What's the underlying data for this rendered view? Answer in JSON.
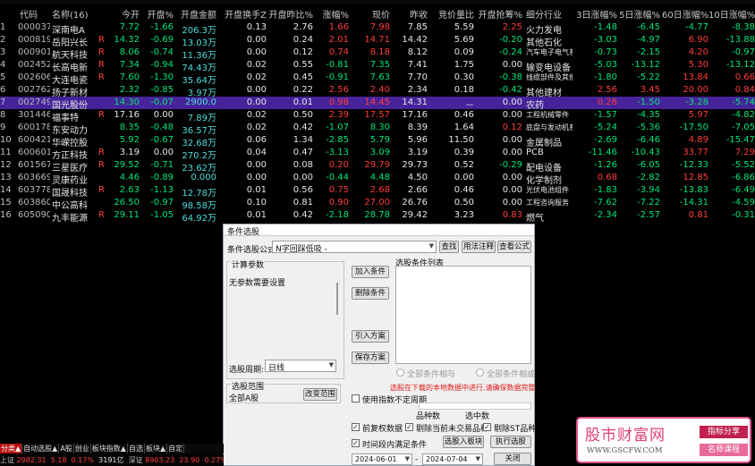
{
  "columns": [
    "代码",
    "名称(16)",
    "今开",
    "开盘%",
    "开盘金额",
    "开盘换手Z",
    "开盘昨比%",
    "涨幅%",
    "现价",
    "昨收",
    "竞价量比",
    "开盘抢筹%",
    "细分行业",
    "3日涨幅%",
    "5日涨幅%",
    "60日涨幅%",
    "10日涨幅%"
  ],
  "rows": [
    {
      "idx": "1",
      "code": "000037",
      "name": "深南电A",
      "mark": "",
      "open": "7.72",
      "open_pct": "-1.66",
      "amt": "206.3万",
      "turnover": "0.13",
      "prev_ratio": "2.76",
      "chg": "1.66",
      "price": "7.98",
      "prev": "7.85",
      "vol_ratio": "5.59",
      "grab": "2.25",
      "ind": "火力发电",
      "d3": "-1.48",
      "d5": "-6.45",
      "d60": "-4.77",
      "d10": "-8.38"
    },
    {
      "idx": "2",
      "code": "000819",
      "name": "岳阳兴长",
      "mark": "R",
      "open": "14.32",
      "open_pct": "-0.69",
      "amt": "13.03万",
      "turnover": "0.00",
      "prev_ratio": "0.24",
      "chg": "2.01",
      "price": "14.71",
      "prev": "14.42",
      "vol_ratio": "5.69",
      "grab": "-0.20",
      "ind": "其他石化",
      "d3": "-3.03",
      "d5": "-4.97",
      "d60": "6.90",
      "d10": "-13.88"
    },
    {
      "idx": "3",
      "code": "000901",
      "name": "航天科技",
      "mark": "R",
      "open": "8.06",
      "open_pct": "-0.74",
      "amt": "11.36万",
      "turnover": "0.00",
      "prev_ratio": "0.12",
      "chg": "0.74",
      "price": "8.18",
      "prev": "8.12",
      "vol_ratio": "0.09",
      "grab": "-0.24",
      "ind": "汽车电子电气系",
      "d3": "-0.73",
      "d5": "-2.15",
      "d60": "4.20",
      "d10": "-0.97"
    },
    {
      "idx": "4",
      "code": "002452",
      "name": "长高电新",
      "mark": "R",
      "open": "7.34",
      "open_pct": "-0.94",
      "amt": "74.43万",
      "turnover": "0.02",
      "prev_ratio": "0.55",
      "chg": "-0.81",
      "price": "7.35",
      "prev": "7.41",
      "vol_ratio": "1.75",
      "grab": "0.00",
      "ind": "输变电设备",
      "d3": "-5.03",
      "d5": "-13.12",
      "d60": "5.30",
      "d10": "-13.12"
    },
    {
      "idx": "5",
      "code": "002606",
      "name": "大连电瓷",
      "mark": "R",
      "open": "7.60",
      "open_pct": "-1.30",
      "amt": "35.64万",
      "turnover": "0.02",
      "prev_ratio": "0.45",
      "chg": "-0.91",
      "price": "7.63",
      "prev": "7.70",
      "vol_ratio": "0.30",
      "grab": "-0.38",
      "ind": "线缆部件及其他",
      "d3": "-1.80",
      "d5": "-5.22",
      "d60": "13.84",
      "d10": "0.66"
    },
    {
      "idx": "6",
      "code": "002762",
      "name": "扬子新材",
      "mark": "",
      "open": "2.32",
      "open_pct": "-0.85",
      "amt": "3.97万",
      "turnover": "0.00",
      "prev_ratio": "0.22",
      "chg": "2.56",
      "price": "2.40",
      "prev": "2.34",
      "vol_ratio": "0.18",
      "grab": "-0.42",
      "ind": "其他建材",
      "d3": "2.56",
      "d5": "3.45",
      "d60": "20.00",
      "d10": "0.84"
    },
    {
      "idx": "7",
      "code": "002749",
      "name": "国光股份",
      "mark": "",
      "open": "14.30",
      "open_pct": "-0.07",
      "amt": "2900.0",
      "turnover": "0.00",
      "prev_ratio": "0.01",
      "chg": "0.98",
      "price": "14.45",
      "prev": "14.31",
      "vol_ratio": "－",
      "grab": "0.00",
      "ind": "农药",
      "d3": "0.28",
      "d5": "-1.50",
      "d60": "-3.28",
      "d10": "-5.74"
    },
    {
      "idx": "8",
      "code": "301446",
      "name": "福事特",
      "mark": "R",
      "open": "17.16",
      "open_pct": "0.00",
      "amt": "7.89万",
      "turnover": "0.02",
      "prev_ratio": "0.50",
      "chg": "2.39",
      "price": "17.57",
      "prev": "17.16",
      "vol_ratio": "0.46",
      "grab": "0.00",
      "ind": "工程机械零件",
      "d3": "-1.57",
      "d5": "-4.35",
      "d60": "5.97",
      "d10": "-4.82"
    },
    {
      "idx": "9",
      "code": "600178",
      "name": "东安动力",
      "mark": "",
      "open": "8.35",
      "open_pct": "-0.48",
      "amt": "36.57万",
      "turnover": "0.02",
      "prev_ratio": "0.42",
      "chg": "-1.07",
      "price": "8.30",
      "prev": "8.39",
      "vol_ratio": "1.64",
      "grab": "0.12",
      "ind": "底盘与发动机系",
      "d3": "-5.24",
      "d5": "-5.36",
      "d60": "-17.50",
      "d10": "-7.05"
    },
    {
      "idx": "10",
      "code": "600421",
      "name": "华嵘控股",
      "mark": "",
      "open": "5.92",
      "open_pct": "-0.67",
      "amt": "32.68万",
      "turnover": "0.06",
      "prev_ratio": "1.34",
      "chg": "-2.85",
      "price": "5.79",
      "prev": "5.96",
      "vol_ratio": "11.50",
      "grab": "0.00",
      "ind": "金属制品",
      "d3": "-2.69",
      "d5": "-6.46",
      "d60": "4.89",
      "d10": "-15.47"
    },
    {
      "idx": "11",
      "code": "600601",
      "name": "方正科技",
      "mark": "R",
      "open": "3.19",
      "open_pct": "0.00",
      "amt": "270.2万",
      "turnover": "0.04",
      "prev_ratio": "0.47",
      "chg": "-3.13",
      "price": "3.09",
      "prev": "3.19",
      "vol_ratio": "0.39",
      "grab": "0.00",
      "ind": "PCB",
      "d3": "-11.46",
      "d5": "-10.43",
      "d60": "33.77",
      "d10": "7.29"
    },
    {
      "idx": "12",
      "code": "601567",
      "name": "三星医疗",
      "mark": "R",
      "open": "29.52",
      "open_pct": "-0.71",
      "amt": "23.62万",
      "turnover": "0.00",
      "prev_ratio": "0.08",
      "chg": "0.20",
      "price": "29.79",
      "prev": "29.73",
      "vol_ratio": "0.52",
      "grab": "-0.29",
      "ind": "配电设备",
      "d3": "-1.26",
      "d5": "-6.05",
      "d60": "-12.33",
      "d10": "-5.52"
    },
    {
      "idx": "13",
      "code": "603669",
      "name": "灵康药业",
      "mark": "",
      "open": "4.46",
      "open_pct": "-0.89",
      "amt": "0.000",
      "turnover": "0.00",
      "prev_ratio": "0.00",
      "chg": "-0.44",
      "price": "4.48",
      "prev": "4.50",
      "vol_ratio": "0.00",
      "grab": "0.00",
      "ind": "化学制剂",
      "d3": "0.68",
      "d5": "-2.82",
      "d60": "12.85",
      "d10": "-6.86"
    },
    {
      "idx": "14",
      "code": "603778",
      "name": "国晟科技",
      "mark": "R",
      "open": "2.63",
      "open_pct": "-1.13",
      "amt": "12.78万",
      "turnover": "0.01",
      "prev_ratio": "0.56",
      "chg": "0.75",
      "price": "2.68",
      "prev": "2.66",
      "vol_ratio": "0.46",
      "grab": "0.00",
      "ind": "光伏电池组件",
      "d3": "-1.83",
      "d5": "-3.94",
      "d60": "-13.83",
      "d10": "-6.49"
    },
    {
      "idx": "15",
      "code": "603860",
      "name": "中公高科",
      "mark": "",
      "open": "26.50",
      "open_pct": "-0.97",
      "amt": "98.58万",
      "turnover": "0.10",
      "prev_ratio": "0.81",
      "chg": "0.90",
      "price": "27.00",
      "prev": "26.76",
      "vol_ratio": "0.50",
      "grab": "0.00",
      "ind": "工程咨询服务",
      "d3": "-7.62",
      "d5": "-7.22",
      "d60": "-14.31",
      "d10": "-4.59"
    },
    {
      "idx": "16",
      "code": "605090",
      "name": "九丰能源",
      "mark": "R",
      "open": "29.11",
      "open_pct": "-1.05",
      "amt": "64.92万",
      "turnover": "0.01",
      "prev_ratio": "0.42",
      "chg": "-2.18",
      "price": "28.78",
      "prev": "29.42",
      "vol_ratio": "3.23",
      "grab": "0.83",
      "ind": "燃气",
      "d3": "-2.34",
      "d5": "-2.57",
      "d60": "0.81",
      "d10": "-0.31"
    }
  ],
  "dialog": {
    "title": "条件选股",
    "formula_label": "条件选股公式",
    "formula_value": "N字回踩低吸 -",
    "find_btn": "查找",
    "usage_btn": "用法注释",
    "view_formula_btn": "查看公式",
    "params_title": "计算参数",
    "params_text": "无参数需要设置",
    "add_cond_btn": "加入条件",
    "del_cond_btn": "删除条件",
    "import_btn": "引入方案",
    "save_btn": "保存方案",
    "cond_list_title": "选股条件列表",
    "period_label": "选股周期:",
    "period_value": "日线",
    "radio_and": "全部条件相与",
    "radio_or": "全部条件相或",
    "hint": "选股在下载的本地数据中进行,请确保数据完整",
    "range_title": "选股范围",
    "range_value": "全部A股",
    "change_range_btn": "改变范围",
    "use_range_label": "使用指数不定周期",
    "count_label": "品种数",
    "selected_label": "选中数",
    "pre_adjust_label": "前复权数据",
    "remove_untraded_label": "剔除当前未交易品种",
    "remove_st_label": "剔除ST品种",
    "time_range_label": "时间段内满足条件",
    "select_to_board_btn": "选股入板块",
    "execute_btn": "执行选股",
    "date_from": "2024-06-01",
    "date_to": "2024-07-04",
    "close_btn": "关闭"
  },
  "bottom_tabs": [
    "分类▲",
    "自动选股▲",
    "A股",
    "创业",
    "板块指数▲",
    "自选",
    "板块▲",
    "自定"
  ],
  "status": {
    "sh_label": "上证",
    "sh_value": "2982.31",
    "sh_chg": "5.18",
    "sh_pct": "0.17%",
    "sh_amt": "3191亿",
    "sz_label": "深证",
    "sz_value": "8903.23",
    "sz_chg": "23.90",
    "sz_pct": "0.27%",
    "sz_amt": "35"
  },
  "watermark": {
    "title": "股市财富网",
    "url": "WWW.GSCFW.COM",
    "badge1": "指标分享",
    "badge2": "名师课程"
  }
}
